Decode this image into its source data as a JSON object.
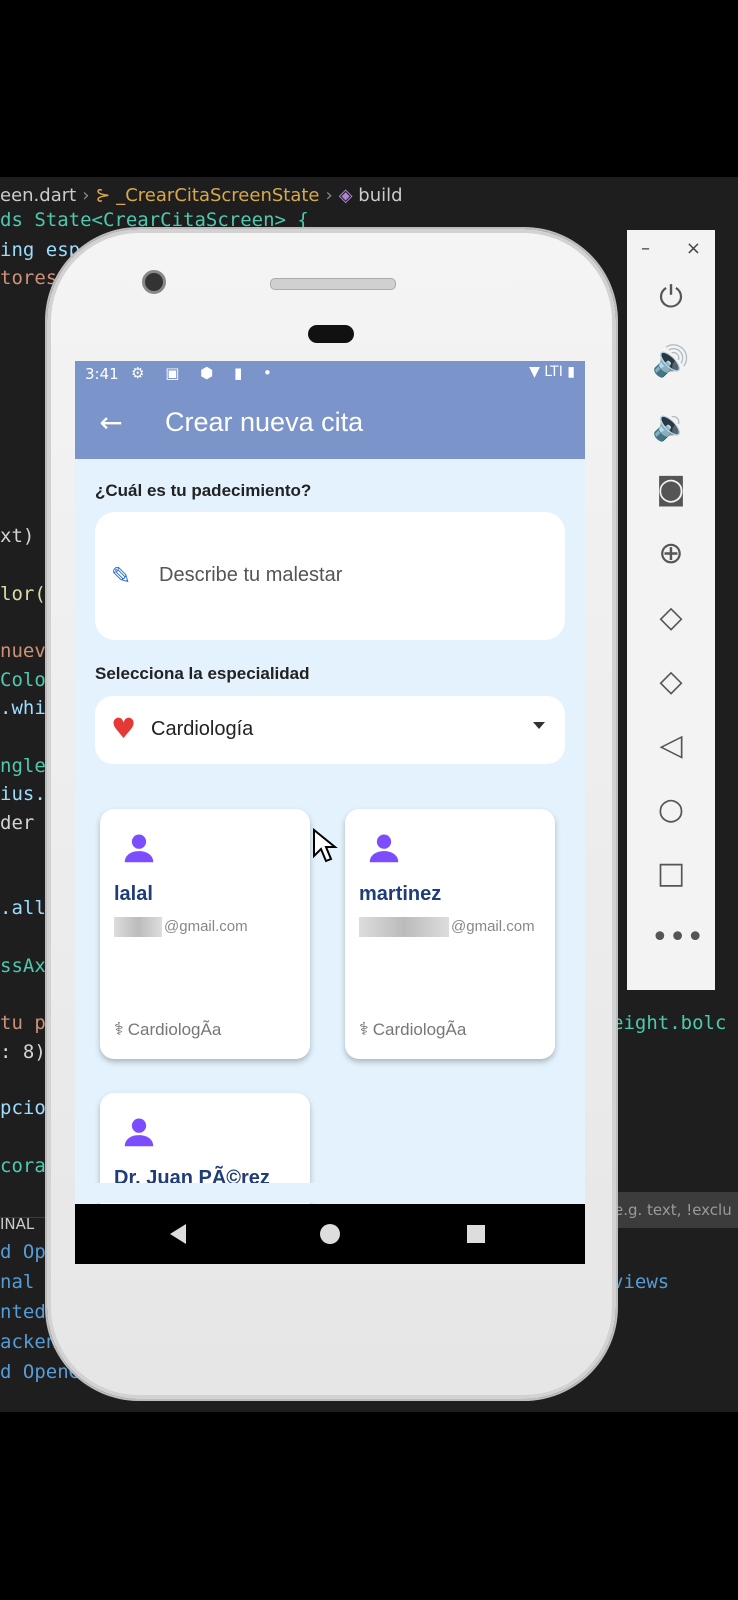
{
  "editor": {
    "breadcrumb": {
      "file": "een.dart",
      "class": "_CrearCitaScreenState",
      "method": "build"
    },
    "code_fragments": [
      "ds State<CrearCitaScreen> {",
      "ing esp",
      "tores",
      "xt)",
      "lor(",
      "nueva",
      "Colo",
      ".whi",
      "ngle",
      "ius.",
      "der",
      ".all",
      "ssAx",
      "tu pa",
      ": 8)",
      "pcio",
      "corat"
    ],
    "code_right": [
      "eight.bolc",
      "views"
    ],
    "terminal_label": "INAL",
    "terminal_lines": [
      "d Op",
      "nal",
      "nted",
      "ackend",
      "d OpenGL ES"
    ],
    "filter_placeholder": "e.g. text, !exclu"
  },
  "statusbar": {
    "time": "3:41",
    "icons": "⚙ ▣ ⬢ ▮ •",
    "right": "▼ LTI ▮"
  },
  "appbar": {
    "back": "←",
    "title": "Crear nueva cita"
  },
  "form": {
    "padecimiento_label": "¿Cuál es tu padecimiento?",
    "padecimiento_placeholder": "Describe tu malestar",
    "especialidad_label": "Selecciona la especialidad",
    "especialidad_value": "Cardiología"
  },
  "doctors": [
    {
      "name": "lalal",
      "email": "@gmail.com",
      "specialty": "CardiologÃ­a"
    },
    {
      "name": "martinez",
      "email": "@gmail.com",
      "specialty": "CardiologÃ­a"
    },
    {
      "name": "Dr. Juan PÃ©rez",
      "email": "",
      "specialty": ""
    }
  ],
  "colors": {
    "appbar": "#7b94c9",
    "background": "#e3f2fd",
    "icon_purple": "#7c4dff",
    "name_blue": "#1f3d7a"
  },
  "toolbar": {
    "minimize": "–",
    "close": "×",
    "buttons": [
      "power-icon",
      "volume-up-icon",
      "volume-down-icon",
      "camera-icon",
      "zoom-icon",
      "rotate-left-icon",
      "rotate-right-icon",
      "back-icon",
      "home-icon",
      "overview-icon",
      "more-icon"
    ]
  }
}
